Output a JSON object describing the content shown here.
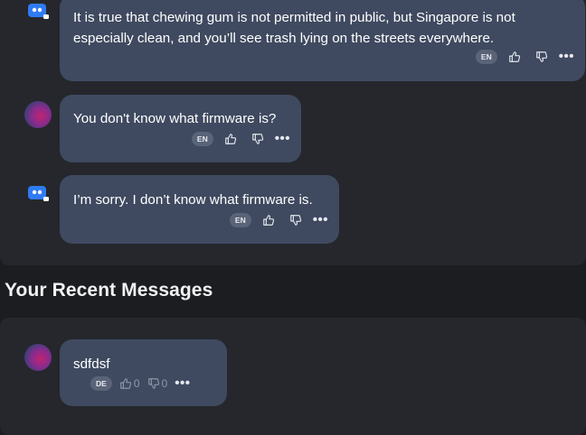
{
  "conversation": {
    "messages": [
      {
        "sender": "bot",
        "text_line1": "It is true that chewing gum is not permitted in public, but Singapore is not",
        "text_line2": "especially clean, and you’ll see trash lying on the streets everywhere.",
        "lang": "EN"
      },
      {
        "sender": "user",
        "text_line1": "You don't know what firmware is?",
        "lang": "EN"
      },
      {
        "sender": "bot",
        "text_line1": "I’m sorry. I don’t know what firmware is.",
        "lang": "EN"
      }
    ]
  },
  "recent": {
    "title": "Your Recent Messages",
    "message": {
      "text": "sdfdsf",
      "lang": "DE",
      "likes": "0",
      "dislikes": "0"
    }
  },
  "icons": {
    "bot_avatar": "robot-avatar-icon",
    "user_avatar": "user-avatar",
    "like": "thumbs-up-icon",
    "dislike": "thumbs-down-icon",
    "more": "more-dots-icon"
  },
  "colors": {
    "background": "#1b1d21",
    "panel": "#25272c",
    "bubble": "#3f4a60",
    "lang_badge": "#5a6478",
    "bot_avatar_blue": "#2f7bf2"
  }
}
